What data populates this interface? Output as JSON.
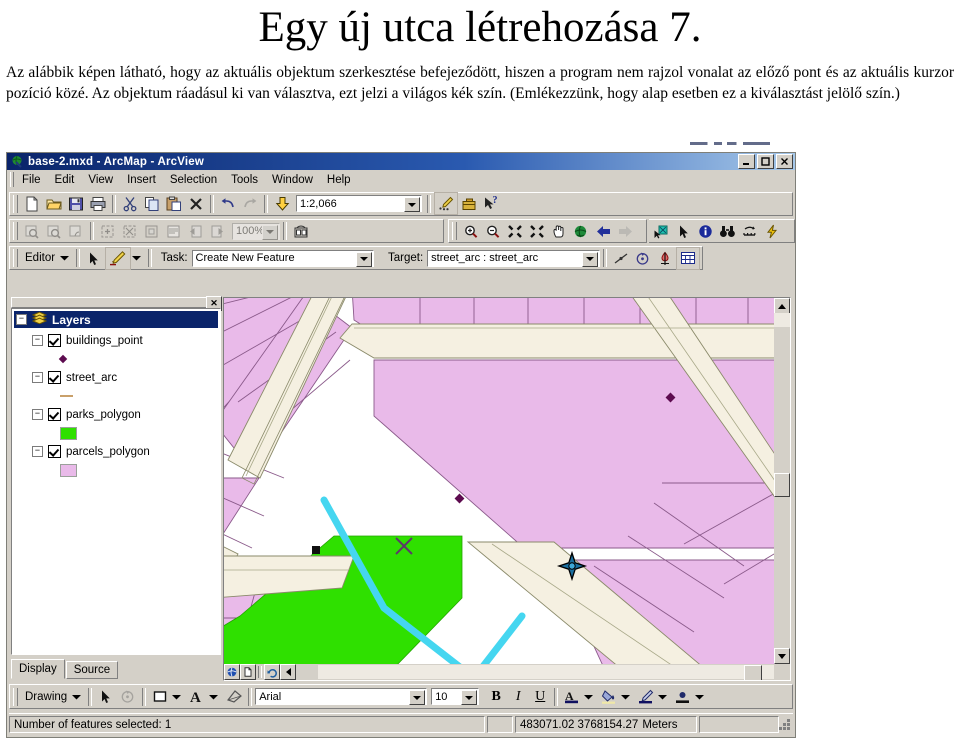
{
  "document": {
    "title": "Egy új utca létrehozása 7.",
    "paragraph": "Az alábbik képen látható, hogy az aktuális objektum szerkesztése befejeződött, hiszen a program nem rajzol vonalat az előző pont és az aktuális kurzor pozíció közé. Az objektum ráadásul ki van választva, ezt jelzi a világos kék szín. (Emlékezzünk, hogy alap esetben ez a kiválasztást jelölő szín.)"
  },
  "window": {
    "title": "base-2.mxd - ArcMap - ArcView",
    "icon": "arcmap-globe-icon",
    "minimize_label": "_",
    "maximize_label": "□",
    "close_label": "✕"
  },
  "menubar": {
    "items": [
      {
        "label": "File",
        "accel": "F"
      },
      {
        "label": "Edit",
        "accel": "E"
      },
      {
        "label": "View",
        "accel": "V"
      },
      {
        "label": "Insert",
        "accel": "I"
      },
      {
        "label": "Selection",
        "accel": "S"
      },
      {
        "label": "Tools",
        "accel": "T"
      },
      {
        "label": "Window",
        "accel": "W"
      },
      {
        "label": "Help",
        "accel": "H"
      }
    ]
  },
  "standard_toolbar": {
    "buttons": [
      {
        "name": "new-document-icon",
        "title": "New"
      },
      {
        "name": "open-folder-icon",
        "title": "Open"
      },
      {
        "name": "save-icon",
        "title": "Save"
      },
      {
        "name": "print-icon",
        "title": "Print"
      },
      {
        "name": "cut-scissors-icon",
        "title": "Cut"
      },
      {
        "name": "copy-icon",
        "title": "Copy"
      },
      {
        "name": "paste-icon",
        "title": "Paste"
      },
      {
        "name": "delete-x-icon",
        "title": "Delete"
      },
      {
        "name": "undo-arrow-icon",
        "title": "Undo"
      },
      {
        "name": "redo-arrow-icon",
        "title": "Redo"
      },
      {
        "name": "add-data-icon",
        "title": "Add Data"
      }
    ],
    "scale": {
      "value": "1:2,066",
      "name": "map-scale-combo"
    },
    "right_buttons": [
      {
        "name": "editor-toolbar-icon",
        "title": "Editor Toolbar"
      },
      {
        "name": "arctoolbox-icon",
        "title": "ArcToolbox"
      },
      {
        "name": "context-help-icon",
        "title": "What's This?"
      }
    ]
  },
  "tools_toolbar": {
    "left_buttons": [
      {
        "name": "layout-zoom-in-icon",
        "disabled": true
      },
      {
        "name": "layout-zoom-out-icon",
        "disabled": true
      },
      {
        "name": "layout-pan-icon",
        "disabled": true
      },
      {
        "name": "fixed-zoom-in-icon",
        "disabled": true
      },
      {
        "name": "fixed-zoom-out-icon",
        "disabled": true
      },
      {
        "name": "zoom-whole-page-icon",
        "disabled": true
      },
      {
        "name": "zoom-page-width-icon",
        "disabled": true
      },
      {
        "name": "go-back-extent-icon",
        "disabled": true
      },
      {
        "name": "go-forward-extent-icon",
        "disabled": true
      }
    ],
    "zoom_percent": {
      "value": "100%",
      "disabled": true,
      "name": "layout-zoom-combo"
    },
    "toggle_draft": {
      "name": "toggle-draft-mode-icon"
    },
    "right_buttons": [
      {
        "name": "zoom-in-magnifier-icon"
      },
      {
        "name": "zoom-out-magnifier-icon"
      },
      {
        "name": "fixed-zoom-in-arrows-icon"
      },
      {
        "name": "fixed-zoom-out-arrows-icon"
      },
      {
        "name": "pan-hand-icon"
      },
      {
        "name": "full-extent-globe-icon"
      },
      {
        "name": "back-extent-arrow-icon"
      },
      {
        "name": "forward-extent-arrow-icon"
      },
      {
        "name": "select-features-icon"
      },
      {
        "name": "select-elements-arrow-icon"
      },
      {
        "name": "identify-info-icon"
      },
      {
        "name": "find-binoculars-icon"
      },
      {
        "name": "measure-icon"
      },
      {
        "name": "hyperlink-lightning-icon"
      }
    ]
  },
  "editor_toolbar": {
    "menu_label": "Editor",
    "menu_accel": "d",
    "edit-tool": {
      "name": "edit-arrow-icon"
    },
    "sketch-tool": {
      "name": "sketch-pencil-icon",
      "active": true
    },
    "task": {
      "label": "Task:",
      "value": "Create New Feature",
      "name": "edit-task-combo"
    },
    "target": {
      "label": "Target:",
      "value": "street_arc : street_arc",
      "name": "edit-target-combo"
    },
    "right_buttons": [
      {
        "name": "split-tool-icon"
      },
      {
        "name": "rotate-tool-icon"
      },
      {
        "name": "attributes-icon"
      },
      {
        "name": "sketch-properties-icon"
      }
    ]
  },
  "toc": {
    "close_label": "✕",
    "root": {
      "label": "Layers",
      "expand": "−",
      "icon": "layers-stack-icon"
    },
    "layers": [
      {
        "label": "buildings_point",
        "expand": "−",
        "checked": true,
        "symbol": "point",
        "symbol_color": "#5d0b4f"
      },
      {
        "label": "street_arc",
        "expand": "−",
        "checked": true,
        "symbol": "line",
        "symbol_color": "#c9a06a"
      },
      {
        "label": "parks_polygon",
        "expand": "−",
        "checked": true,
        "symbol": "fill",
        "symbol_color": "#2fe000"
      },
      {
        "label": "parcels_polygon",
        "expand": "−",
        "checked": true,
        "symbol": "fill",
        "symbol_color": "#e9bae9"
      }
    ],
    "tabs": [
      {
        "label": "Display",
        "active": true
      },
      {
        "label": "Source",
        "active": false
      }
    ]
  },
  "map": {
    "colors": {
      "parcel_fill": "#e9bae9",
      "parcel_outline": "#8a5a8a",
      "park_fill": "#2fe000",
      "street_fill": "#f5f0e1",
      "street_outline": "#8a8a6a",
      "selected_line": "#45d6f0",
      "point_marker": "#5d0b4f",
      "background": "#ffffff"
    },
    "selected_feature": "new street line sketch (cyan)",
    "cursor_icon": "crosshair-target-cursor",
    "sketch_x_marker": "sketch-endpoint-x"
  },
  "dataview_buttons": [
    {
      "name": "data-view-icon"
    },
    {
      "name": "layout-view-icon"
    },
    {
      "name": "refresh-view-icon"
    },
    {
      "name": "pause-drawing-icon"
    }
  ],
  "drawing_toolbar": {
    "menu_label": "Drawing",
    "menu_accel": "D",
    "buttons": [
      {
        "name": "select-elements-arrow-icon"
      },
      {
        "name": "rotate-element-icon",
        "disabled": true
      },
      {
        "name": "new-rectangle-icon"
      },
      {
        "name": "new-text-icon"
      },
      {
        "name": "nudge-icon"
      }
    ],
    "font": {
      "value": "Arial",
      "name": "font-family-combo"
    },
    "size": {
      "value": "10",
      "name": "font-size-combo"
    },
    "bold": {
      "label": "B",
      "name": "bold-button"
    },
    "italic": {
      "label": "I",
      "name": "italic-button"
    },
    "underline": {
      "label": "U",
      "name": "underline-button"
    },
    "color_buttons": [
      {
        "name": "font-color-icon"
      },
      {
        "name": "fill-color-icon"
      },
      {
        "name": "line-color-icon"
      },
      {
        "name": "marker-color-icon"
      }
    ]
  },
  "statusbar": {
    "message": "Number of features selected: 1",
    "coordinates": "483071.02  3768154.27",
    "units": "Meters"
  }
}
